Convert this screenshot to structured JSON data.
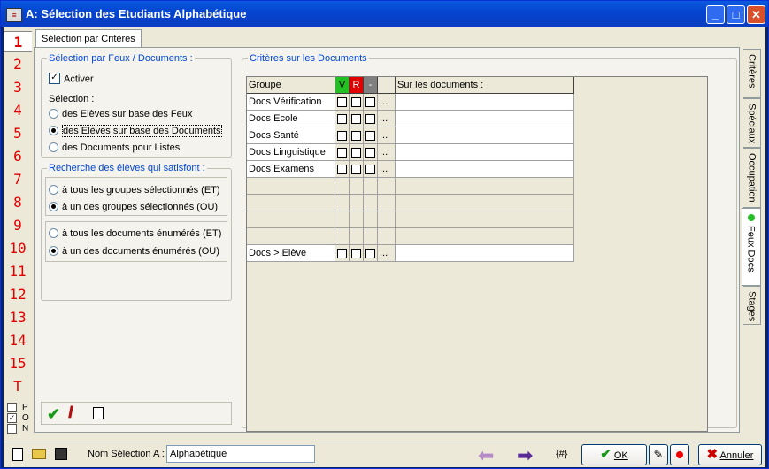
{
  "window": {
    "title": "A: Sélection des Etudiants Alphabétique",
    "minimize": "_",
    "maximize": "□",
    "close": "✕"
  },
  "numbers": [
    "1",
    "2",
    "3",
    "4",
    "5",
    "6",
    "7",
    "8",
    "9",
    "10",
    "11",
    "12",
    "13",
    "14",
    "15",
    "T"
  ],
  "pon": {
    "p_label": "P",
    "o_label": "O",
    "n_label": "N",
    "o_checked": "✓"
  },
  "tab_main": "Sélection par Critères",
  "group_feux": {
    "legend": "Sélection par Feux / Documents :",
    "activer_label": "Activer",
    "activer_mark": "✓",
    "selection_label": "Sélection :",
    "options": [
      "des Elèves sur base des Feux",
      "des Elèves sur base des Documents",
      "des Documents pour Listes"
    ]
  },
  "group_recherche": {
    "legend": "Recherche des élèves qui satisfont :",
    "groupes_options": [
      "à tous les groupes sélectionnés (ET)",
      "à un des groupes sélectionnés (OU)"
    ],
    "documents_options": [
      "à tous les documents énumérés (ET)",
      "à un des documents énumérés (OU)"
    ]
  },
  "criteres": {
    "legend": "Critères sur les Documents",
    "headers": {
      "groupe": "Groupe",
      "v": "V",
      "r": "R",
      "dash": "-",
      "sur": "Sur les documents :"
    },
    "rows": [
      "Docs Vérification",
      "Docs Ecole",
      "Docs Santé",
      "Docs Linguistique",
      "Docs Examens"
    ],
    "footer_row": "Docs > Elève",
    "ellipsis": "..."
  },
  "side_tabs": [
    "Critères",
    "Spéciaux",
    "Occupation",
    "Feux Docs",
    "Stages"
  ],
  "bottom": {
    "nom_label": "Nom Sélection A :",
    "nom_value": "Alphabétique",
    "hash_label": "{#}",
    "ok_label": "OK",
    "annuler_label": "Annuler"
  },
  "colors": {
    "v_green": "#22C022",
    "r_red": "#E00000",
    "number_red": "#E00000",
    "legend_blue": "#0046D5"
  }
}
